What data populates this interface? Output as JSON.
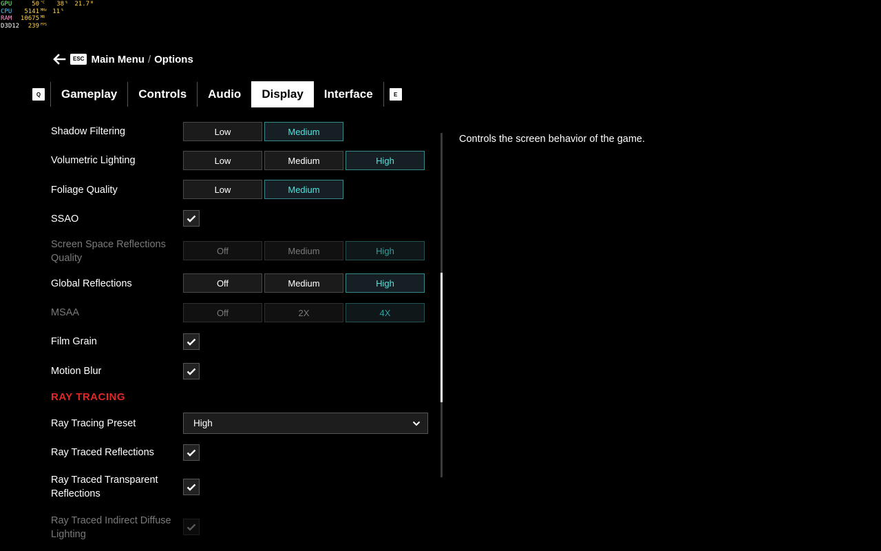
{
  "hud": [
    {
      "label": "GPU",
      "values": [
        {
          "value": "50",
          "unit": "°C"
        },
        {
          "value": "38",
          "unit": "%"
        },
        {
          "value": "21.7",
          "unit": "W"
        }
      ]
    },
    {
      "label": "CPU",
      "values": [
        {
          "value": "5141",
          "unit": "MHz"
        },
        {
          "value": "11",
          "unit": "%"
        }
      ]
    },
    {
      "label": "RAM",
      "values": [
        {
          "value": "10675",
          "unit": "MB"
        }
      ]
    },
    {
      "label": "D3D12",
      "values": [
        {
          "value": "239",
          "unit": "FPS"
        }
      ]
    }
  ],
  "breadcrumb": {
    "esc": "ESC",
    "parent": "Main Menu",
    "separator": "/",
    "current": "Options"
  },
  "tabs": {
    "left_key": "Q",
    "right_key": "E",
    "items": [
      {
        "label": "Gameplay"
      },
      {
        "label": "Controls"
      },
      {
        "label": "Audio"
      },
      {
        "label": "Display",
        "active": true
      },
      {
        "label": "Interface"
      }
    ]
  },
  "settings": {
    "shadow_filtering": {
      "label": "Shadow Filtering",
      "options": [
        "Low",
        "Medium"
      ],
      "selected": "Medium"
    },
    "volumetric_lighting": {
      "label": "Volumetric Lighting",
      "options": [
        "Low",
        "Medium",
        "High"
      ],
      "selected": "High"
    },
    "foliage_quality": {
      "label": "Foliage Quality",
      "options": [
        "Low",
        "Medium"
      ],
      "selected": "Medium"
    },
    "ssao": {
      "label": "SSAO",
      "checked": true
    },
    "ssr_quality": {
      "label": "Screen Space Reflections Quality",
      "options": [
        "Off",
        "Medium",
        "High"
      ],
      "selected": "High",
      "disabled": true
    },
    "global_reflections": {
      "label": "Global Reflections",
      "options": [
        "Off",
        "Medium",
        "High"
      ],
      "selected": "High"
    },
    "msaa": {
      "label": "MSAA",
      "options": [
        "Off",
        "2X",
        "4X"
      ],
      "selected": "4X",
      "disabled": true
    },
    "film_grain": {
      "label": "Film Grain",
      "checked": true
    },
    "motion_blur": {
      "label": "Motion Blur",
      "checked": true
    }
  },
  "ray_tracing": {
    "title": "RAY TRACING",
    "preset": {
      "label": "Ray Tracing Preset",
      "value": "High"
    },
    "reflections": {
      "label": "Ray Traced Reflections",
      "checked": true
    },
    "transparent_reflections": {
      "label": "Ray Traced Transparent Reflections",
      "checked": true
    },
    "indirect_diffuse": {
      "label": "Ray Traced Indirect Diffuse Lighting",
      "checked": true,
      "disabled": true
    }
  },
  "description": "Controls the screen behavior of the game.",
  "colors": {
    "accent": "#4de4e0",
    "section": "#e32626"
  }
}
